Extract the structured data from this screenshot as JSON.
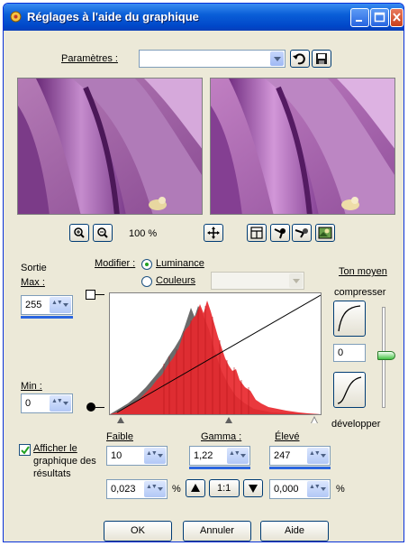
{
  "window": {
    "title": "Réglages à l'aide du graphique"
  },
  "params": {
    "label": "Paramètres :",
    "value": ""
  },
  "zoom": {
    "level": "100 %"
  },
  "sortie": {
    "label": "Sortie",
    "max_label": "Max :",
    "max_value": "255",
    "min_label": "Min :",
    "min_value": "0"
  },
  "modifier": {
    "label": "Modifier :",
    "options": [
      "Luminance",
      "Couleurs"
    ],
    "selected": "Luminance",
    "color_value": ""
  },
  "ton": {
    "label": "Ton moyen",
    "compress_label": "compresser",
    "value": "0",
    "develop_label": "développer"
  },
  "levels": {
    "low_label": "Faible",
    "low_value": "10",
    "low_pct": "0,023",
    "gamma_label": "Gamma :",
    "gamma_value": "1,22",
    "high_label": "Élevé",
    "high_value": "247",
    "high_pct": "0,000",
    "pct_sign": "%",
    "ratio_label": "1:1"
  },
  "show_graph": {
    "line1": "Afficher le",
    "line2": "graphique des",
    "line3": "résultats",
    "checked": true
  },
  "buttons": {
    "ok": "OK",
    "cancel": "Annuler",
    "help": "Aide"
  },
  "colors": {
    "accent": "#2b66e0",
    "hist_red": "#e8282e",
    "hist_gray": "#6b6b6b"
  }
}
